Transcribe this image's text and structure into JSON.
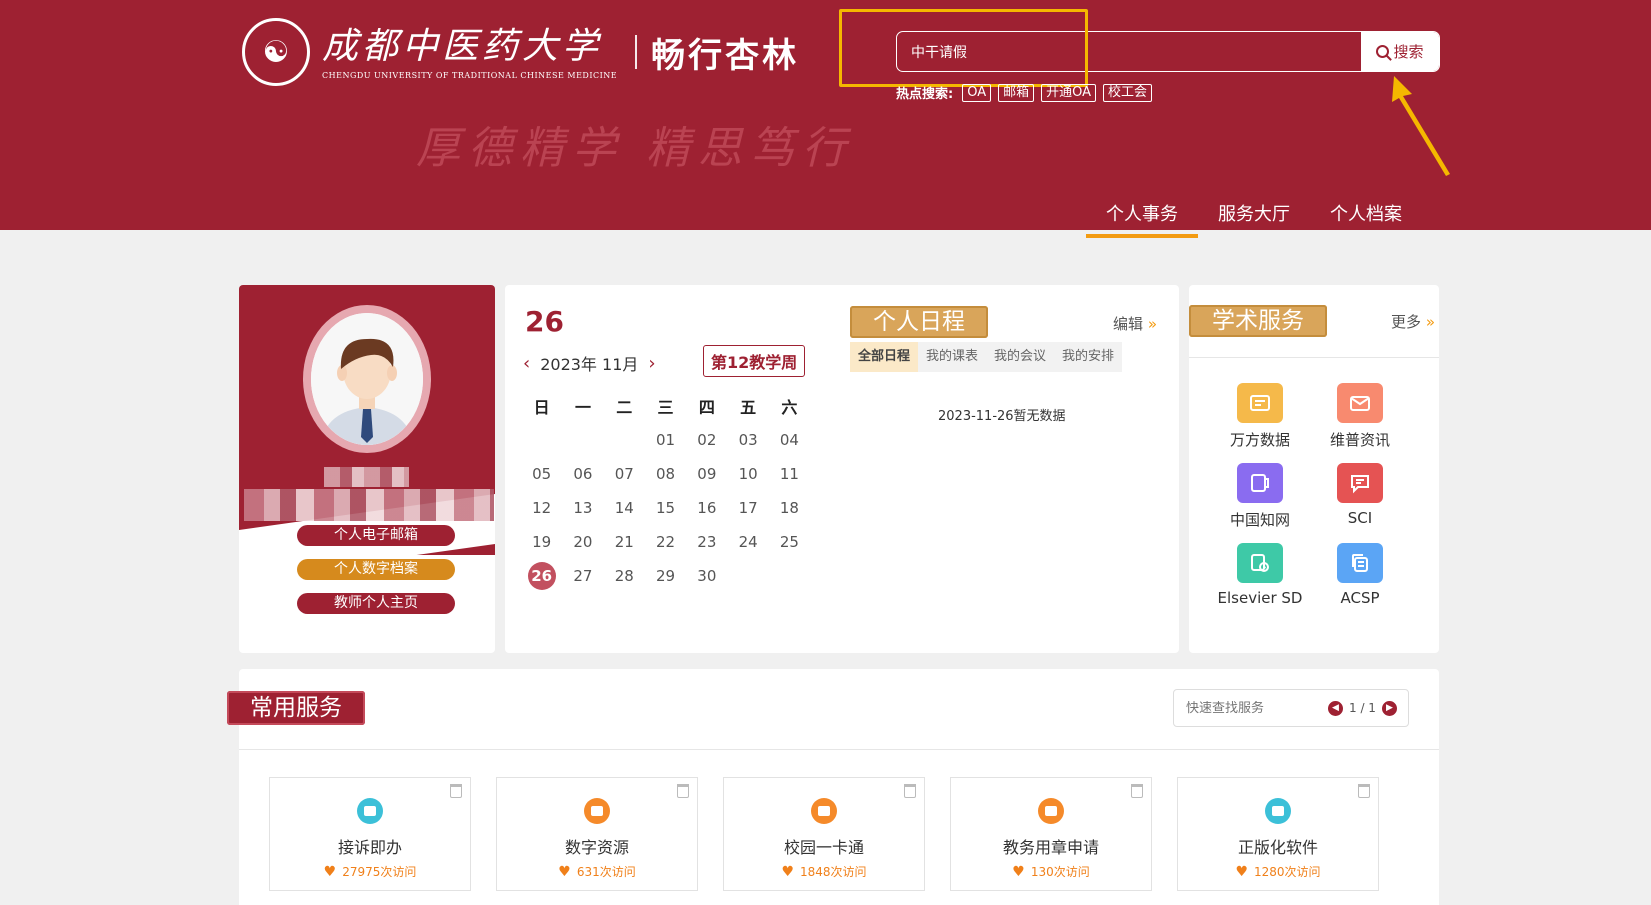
{
  "header": {
    "logo_cn": "成都中医药大学",
    "logo_en": "CHENGDU UNIVERSITY OF TRADITIONAL CHINESE MEDICINE",
    "logo_sub": "畅行杏林",
    "motto": "厚德精学 精思笃行",
    "search": {
      "value": "中干请假",
      "button": "搜索"
    },
    "hot": {
      "label": "热点搜索:",
      "tags": [
        "OA",
        "邮箱",
        "开通OA",
        "校工会"
      ]
    },
    "nav": [
      "个人事务",
      "服务大厅",
      "个人档案"
    ]
  },
  "profile": {
    "buttons": [
      "个人电子邮箱",
      "个人数字档案",
      "教师个人主页"
    ]
  },
  "calendar": {
    "day": "26",
    "month_label": "2023年 11月",
    "week_tag": "第12教学周",
    "weekdays": [
      "日",
      "一",
      "二",
      "三",
      "四",
      "五",
      "六"
    ],
    "weeks": [
      [
        "",
        "",
        "",
        "01",
        "02",
        "03",
        "04"
      ],
      [
        "05",
        "06",
        "07",
        "08",
        "09",
        "10",
        "11"
      ],
      [
        "12",
        "13",
        "14",
        "15",
        "16",
        "17",
        "18"
      ],
      [
        "19",
        "20",
        "21",
        "22",
        "23",
        "24",
        "25"
      ],
      [
        "26",
        "27",
        "28",
        "29",
        "30",
        "",
        ""
      ]
    ],
    "today": "26"
  },
  "schedule": {
    "title": "个人日程",
    "edit": "编辑",
    "tabs": [
      "全部日程",
      "我的课表",
      "我的会议",
      "我的安排"
    ],
    "empty": "2023-11-26暂无数据"
  },
  "academic": {
    "title": "学术服务",
    "more": "更多",
    "items": [
      {
        "label": "万方数据",
        "icon": "card-icon",
        "color": "#f5b94a"
      },
      {
        "label": "维普资讯",
        "icon": "mail-icon",
        "color": "#f88a6f"
      },
      {
        "label": "中国知网",
        "icon": "book-icon",
        "color": "#8a6cf0"
      },
      {
        "label": "SCI",
        "icon": "chat-icon",
        "color": "#e55353"
      },
      {
        "label": "Elsevier SD",
        "icon": "doc-clock-icon",
        "color": "#3ec9a7"
      },
      {
        "label": "ACSP",
        "icon": "copy-icon",
        "color": "#5ba5f5"
      }
    ]
  },
  "services": {
    "title": "常用服务",
    "search_placeholder": "快速查找服务",
    "page": "1 / 1",
    "cards": [
      {
        "name": "接诉即办",
        "visits": "27975次访问",
        "color": "#3cc0d8"
      },
      {
        "name": "数字资源",
        "visits": "631次访问",
        "color": "#f58a2a"
      },
      {
        "name": "校园一卡通",
        "visits": "1848次访问",
        "color": "#f58a2a"
      },
      {
        "name": "教务用章申请",
        "visits": "130次访问",
        "color": "#f58a2a"
      },
      {
        "name": "正版化软件",
        "visits": "1280次访问",
        "color": "#3cc0d8"
      }
    ]
  }
}
